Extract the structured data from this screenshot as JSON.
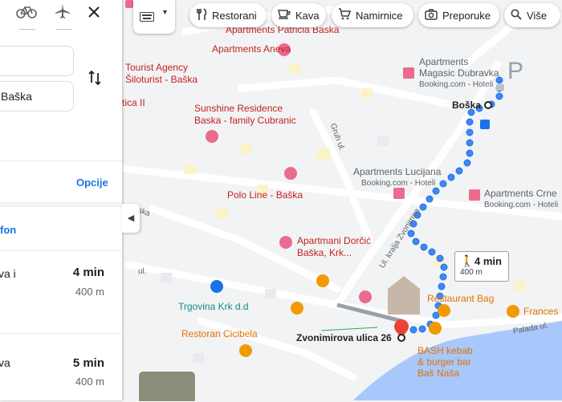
{
  "panel": {
    "mode_icons": [
      "bicycle-icon",
      "airplane-icon",
      "close-icon"
    ],
    "origin_value": "",
    "destination_value": "Baška",
    "swap_icon": "swap-vertical-icon",
    "options_label": "Opcije",
    "phone_link_partial": "fon",
    "routes": [
      {
        "title_partial": "va i",
        "time": "4 min",
        "distance": "400 m"
      },
      {
        "title_partial": "va",
        "time": "5 min",
        "distance": "400 m"
      }
    ]
  },
  "toolbar": {
    "chips": [
      {
        "icon": "fork-knife-icon",
        "label": "Restorani"
      },
      {
        "icon": "coffee-cup-icon",
        "label": "Kava"
      },
      {
        "icon": "cart-icon",
        "label": "Namirnice"
      },
      {
        "icon": "camera-icon",
        "label": "Preporuke"
      },
      {
        "icon": "search-icon",
        "label": "Više"
      }
    ]
  },
  "map": {
    "places": {
      "patricia": "Apartments Patricia Baska",
      "aneva": "Apartments Aneva",
      "tourist_1": "Tourist Agency",
      "tourist_2": "Šiloturist - Baška",
      "tica": "tica II",
      "sunshine_1": "Sunshine Residence",
      "sunshine_2": "Baska - family Cubranic",
      "gruh": "Gruh ul.",
      "masagic_1": "Apartments",
      "masagic_2": "Magasic Dubravka",
      "masagic_sub": "Booking.com - Hoteli",
      "boska": "Boška",
      "lucijana": "Apartments Lucijana",
      "lucijana_sub": "Booking.com - Hoteli",
      "crne": "Apartments Crne",
      "crne_sub": "Booking.com - Hoteli",
      "polo": "Polo Line - Baška",
      "road_ul_kralja": "Ul. kralja Zvonimira",
      "jska": "jska",
      "dorcic_1": "Apartmani Dorčić",
      "dorcic_2": "Baška, Krk...",
      "road_ul": "ul.",
      "trgovina": "Trgovina Krk d.d",
      "restoran_bag": "Restaurant Bag",
      "frances": "Frances",
      "palada": "Palada ul.",
      "cicibela": "Restoran Cicibela",
      "zvonimirova": "Zvonimirova ulica 26",
      "bash_1": "BASH kebab",
      "bash_2": "& burger bar",
      "bash_3": "Baš Naša",
      "p_sign": "P"
    },
    "walk_time": "4 min",
    "walk_distance": "400 m",
    "colors": {
      "route_blue": "#4285f4",
      "route_gray": "#9aa0a6",
      "pin_red": "#ea4335",
      "water": "#a8c7fa"
    }
  }
}
